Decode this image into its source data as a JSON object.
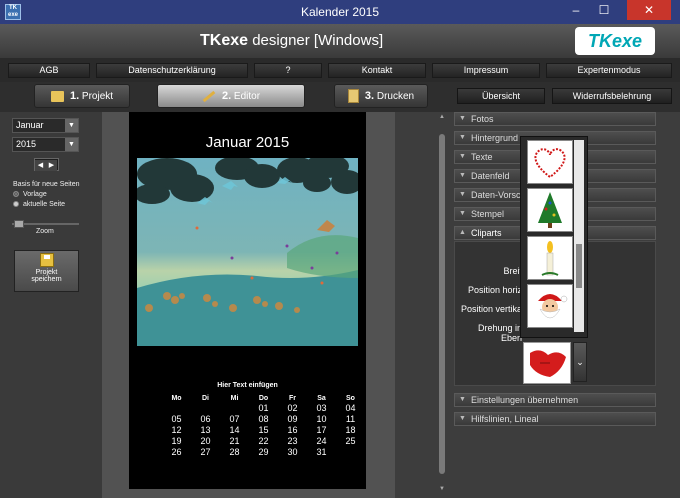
{
  "window": {
    "title": "Kalender 2015",
    "app_icon_text": "TK\nexe",
    "minimize": "–",
    "maximize": "☐",
    "close": "✕"
  },
  "brand": {
    "name": "TKexe",
    "product": "designer",
    "edition": "[Windows]",
    "logo": "TKexe"
  },
  "nav": [
    "AGB",
    "Datenschutzerklärung",
    "?",
    "Kontakt",
    "Impressum",
    "Expertenmodus"
  ],
  "steps": [
    {
      "num": "1.",
      "label": "Projekt"
    },
    {
      "num": "2.",
      "label": "Editor"
    },
    {
      "num": "3.",
      "label": "Drucken"
    }
  ],
  "overview_label": "Übersicht",
  "withdrawal_label": "Widerrufsbelehrung",
  "left": {
    "month": "Januar",
    "year": "2015",
    "basis_label": "Basis für neue Seiten",
    "option_vorlage": "Vorlage",
    "option_aktuelle": "aktuelle Seite",
    "zoom_label": "Zoom",
    "save_label_1": "Projekt",
    "save_label_2": "speichern"
  },
  "page": {
    "title": "Januar 2015",
    "text_placeholder": "Hier Text einfügen",
    "weekdays": [
      "Mo",
      "Di",
      "Mi",
      "Do",
      "Fr",
      "Sa",
      "So"
    ],
    "weeks": [
      [
        "",
        "",
        "",
        "01",
        "02",
        "03",
        "04"
      ],
      [
        "05",
        "06",
        "07",
        "08",
        "09",
        "10",
        "11"
      ],
      [
        "12",
        "13",
        "14",
        "15",
        "16",
        "17",
        "18"
      ],
      [
        "19",
        "20",
        "21",
        "22",
        "23",
        "24",
        "25"
      ],
      [
        "26",
        "27",
        "28",
        "29",
        "30",
        "31",
        ""
      ]
    ]
  },
  "accordion": {
    "fotos": "Fotos",
    "hintergrund": "Hintergrund",
    "texte": "Texte",
    "datenfeld": "Datenfeld",
    "daten_vorschau": "Daten-Vorsch",
    "stempel": "Stempel",
    "cliparts": "Cliparts",
    "einstellungen": "Einstellungen übernehmen",
    "hilfslinien": "Hilfslinien, Lineal"
  },
  "clipart_props": {
    "breite": "Breit",
    "pos_h": "Position horiz",
    "pos_v": "Position vertika",
    "drehung": "Drehung in Eben"
  },
  "clipart_items": [
    "heart-clipart",
    "christmas-tree-clipart",
    "candle-clipart",
    "santa-clipart"
  ],
  "colors": {
    "accent": "#00a7b5",
    "title_bar": "#2f3e7e",
    "close": "#c8352b"
  }
}
